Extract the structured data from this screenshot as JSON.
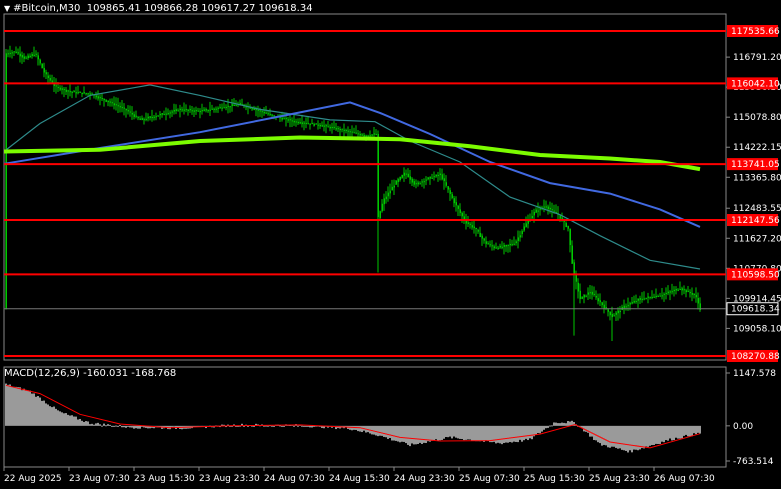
{
  "header": {
    "symbol": "#Bitcoin,M30",
    "ohlc": "109865.41 109866.28 109617.27 109618.34"
  },
  "macd": {
    "label": "MACD(12,26,9) -160.031 -168.768",
    "axis": [
      "1147.578",
      "0.00",
      "-763.514"
    ]
  },
  "price_axis": [
    "116791.20",
    "115936.10",
    "115078.80",
    "114222.15",
    "113365.80",
    "112483.55",
    "111627.20",
    "110770.80",
    "109914.45",
    "109058.10"
  ],
  "current_price": "109618.34",
  "levels": [
    {
      "value": 117535.66,
      "label": "117535.66"
    },
    {
      "value": 116042.1,
      "label": "116042.10"
    },
    {
      "value": 113741.05,
      "label": "113741.05"
    },
    {
      "value": 112147.56,
      "label": "112147.56"
    },
    {
      "value": 110598.5,
      "label": "110598.50"
    },
    {
      "value": 108270.88,
      "label": "108270.88"
    }
  ],
  "time_axis": [
    "22 Aug 2025",
    "23 Aug 07:30",
    "23 Aug 15:30",
    "23 Aug 23:30",
    "24 Aug 07:30",
    "24 Aug 15:30",
    "24 Aug 23:30",
    "25 Aug 07:30",
    "25 Aug 15:30",
    "25 Aug 23:30",
    "26 Aug 07:30"
  ],
  "colors": {
    "background": "#000000",
    "bullish": "#00c800",
    "level": "#ff0000",
    "ma_fast": "#2e8b8b",
    "ma_mid": "#4169e1",
    "ma_slow": "#7cfc00",
    "macd_hist": "#c0c0c0",
    "macd_signal": "#ff0000"
  }
}
